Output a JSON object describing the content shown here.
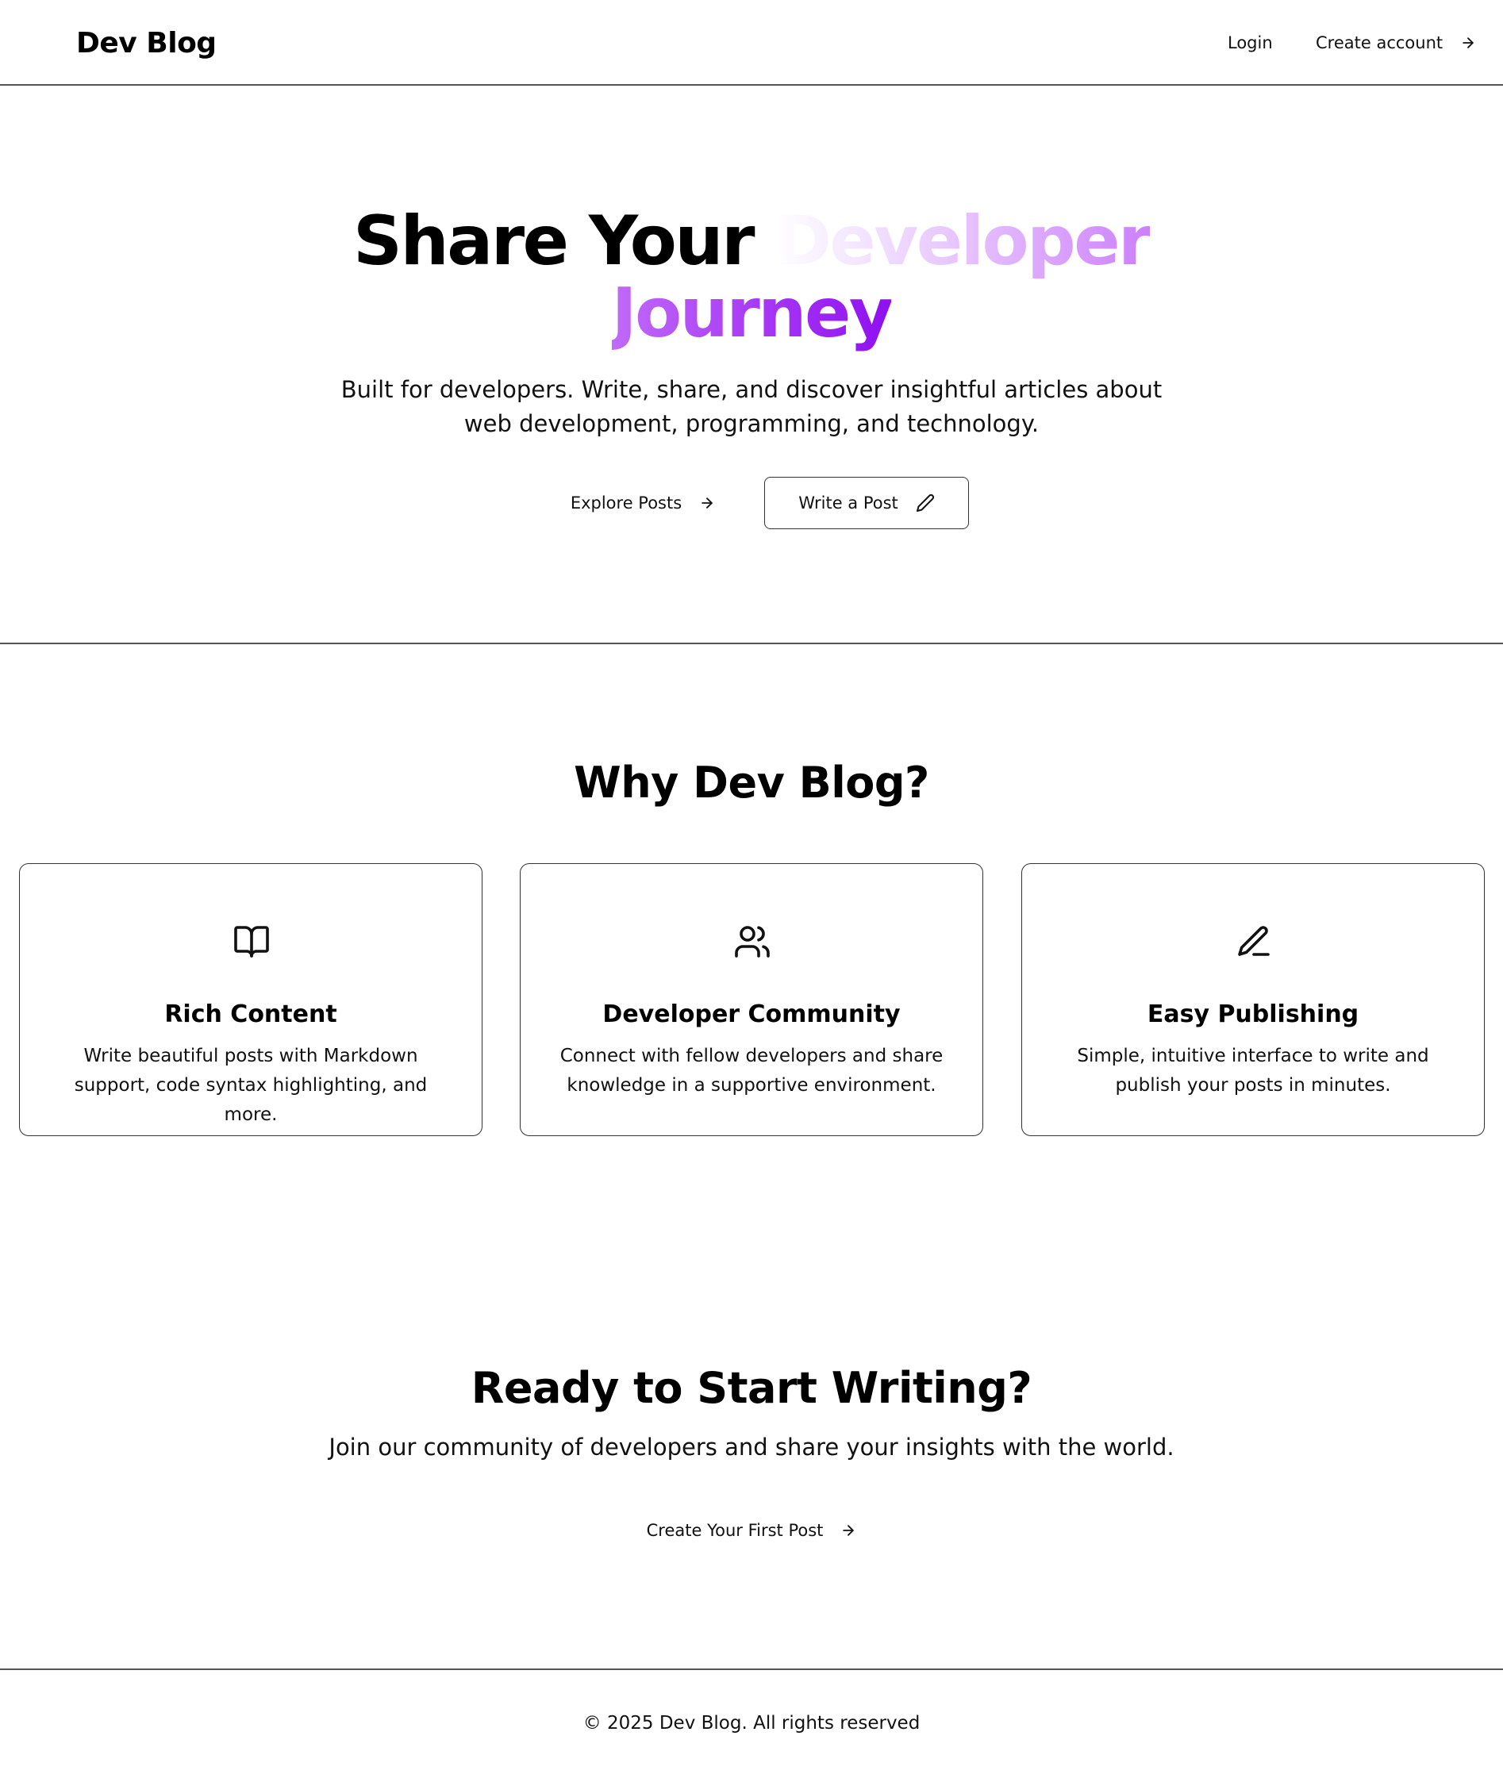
{
  "header": {
    "brand": "Dev Blog",
    "login": "Login",
    "create_account": "Create account"
  },
  "hero": {
    "title_plain": "Share Your ",
    "title_gradient_1": "Developer",
    "title_gradient_2": "Journey",
    "subtitle": "Built for developers. Write, share, and discover insightful articles about web development, programming, and technology.",
    "explore_label": "Explore Posts",
    "write_label": "Write a Post"
  },
  "features": {
    "title": "Why Dev Blog?",
    "cards": [
      {
        "icon": "book-open-icon",
        "title": "Rich Content",
        "description": "Write beautiful posts with Markdown support, code syntax highlighting, and more."
      },
      {
        "icon": "users-icon",
        "title": "Developer Community",
        "description": "Connect with fellow developers and share knowledge in a supportive environment."
      },
      {
        "icon": "pen-line-icon",
        "title": "Easy Publishing",
        "description": "Simple, intuitive interface to write and publish your posts in minutes."
      }
    ]
  },
  "cta": {
    "title": "Ready to Start Writing?",
    "subtitle": "Join our community of developers and share your insights with the world.",
    "button": "Create Your First Post"
  },
  "footer": {
    "text": "© 2025 Dev Blog. All rights reserved"
  },
  "colors": {
    "gradient_start": "#f2e2ff",
    "gradient_mid": "#c06af8",
    "gradient_end": "#8f0ff0"
  }
}
